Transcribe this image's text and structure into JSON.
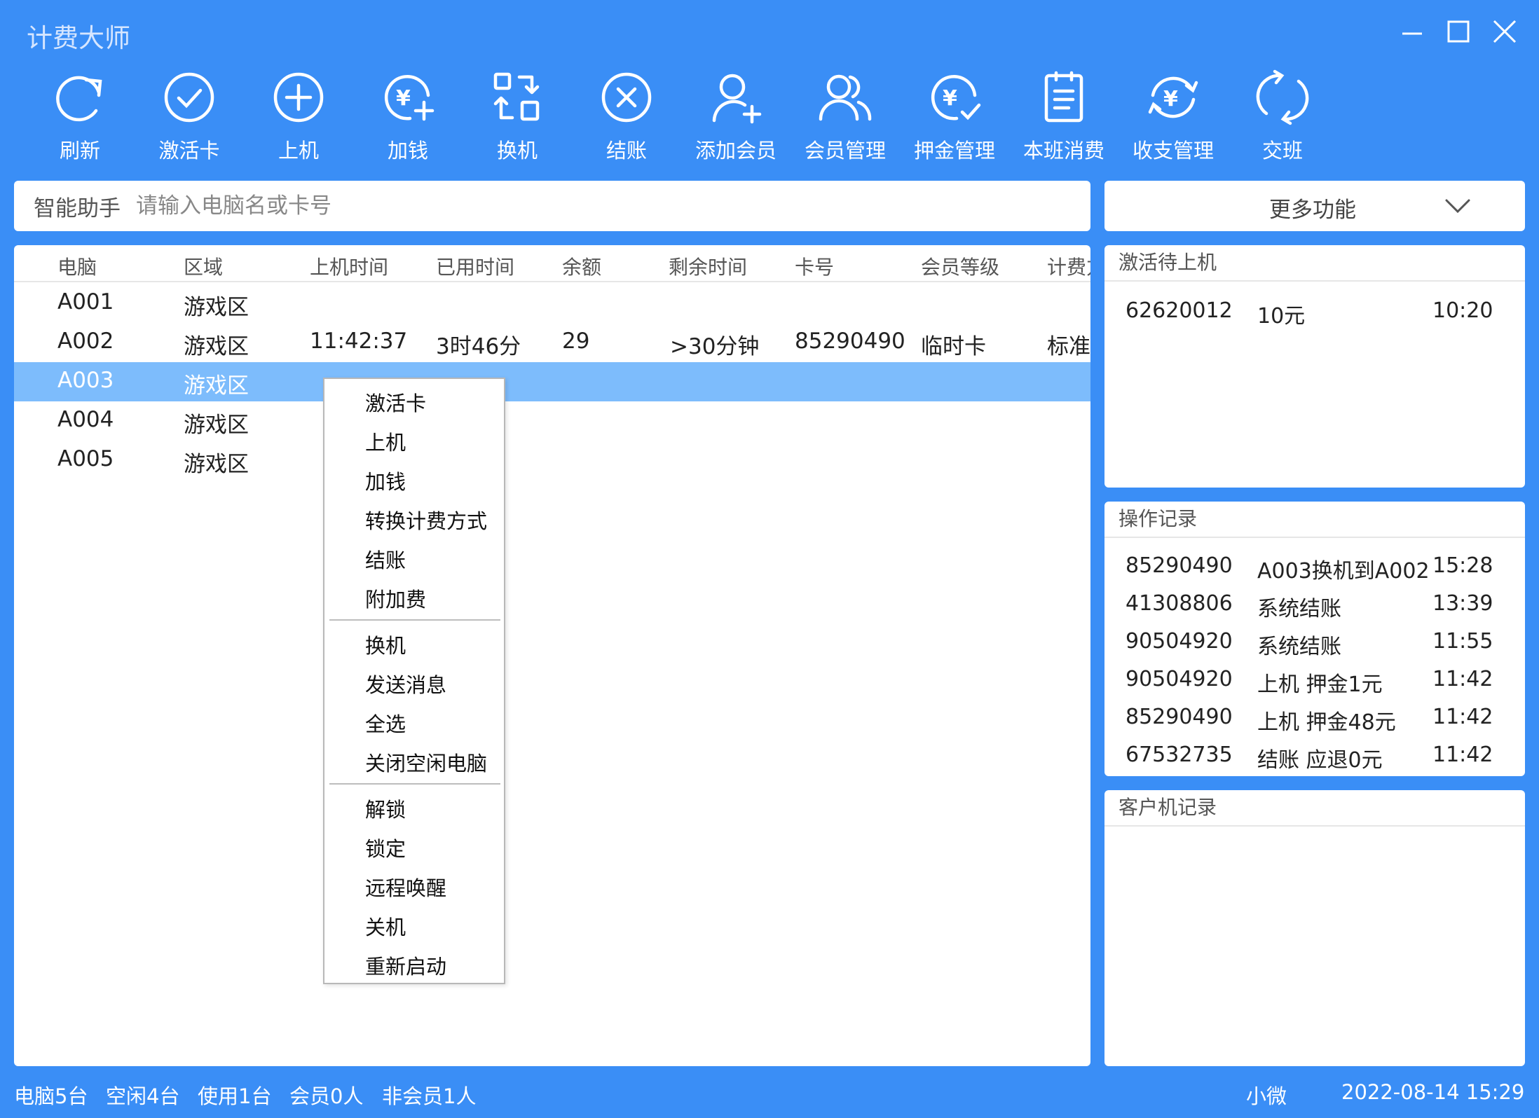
{
  "app_title": "计费大师",
  "window_controls": {
    "minimize": "minimize-icon",
    "maximize": "maximize-icon",
    "close": "close-icon"
  },
  "toolbar": [
    {
      "label": "刷新",
      "icon": "refresh-icon"
    },
    {
      "label": "激活卡",
      "icon": "check-circle-icon"
    },
    {
      "label": "上机",
      "icon": "plus-circle-icon"
    },
    {
      "label": "加钱",
      "icon": "yen-plus-icon"
    },
    {
      "label": "换机",
      "icon": "switch-icon"
    },
    {
      "label": "结账",
      "icon": "x-circle-icon"
    },
    {
      "label": "添加会员",
      "icon": "add-user-icon"
    },
    {
      "label": "会员管理",
      "icon": "users-icon"
    },
    {
      "label": "押金管理",
      "icon": "yen-check-icon"
    },
    {
      "label": "本班消费",
      "icon": "clipboard-icon"
    },
    {
      "label": "收支管理",
      "icon": "yen-cycle-icon"
    },
    {
      "label": "交班",
      "icon": "handover-icon"
    }
  ],
  "search": {
    "label": "智能助手",
    "placeholder": "请输入电脑名或卡号",
    "value": ""
  },
  "more": {
    "label": "更多功能",
    "icon": "chevron-down-icon"
  },
  "table": {
    "columns": [
      "电脑",
      "区域",
      "上机时间",
      "已用时间",
      "余额",
      "剩余时间",
      "卡号",
      "会员等级",
      "计费方"
    ],
    "rows": [
      [
        "A001",
        "游戏区",
        "",
        "",
        "",
        "",
        "",
        "",
        ""
      ],
      [
        "A002",
        "游戏区",
        "11:42:37",
        "3时46分",
        "29",
        ">30分钟",
        "85290490",
        "临时卡",
        "标准"
      ],
      [
        "A003",
        "游戏区",
        "",
        "",
        "",
        "",
        "",
        "",
        ""
      ],
      [
        "A004",
        "游戏区",
        "",
        "",
        "",
        "",
        "",
        "",
        ""
      ],
      [
        "A005",
        "游戏区",
        "",
        "",
        "",
        "",
        "",
        "",
        ""
      ]
    ],
    "selected_row": 2
  },
  "context_menu": {
    "groups": [
      [
        "激活卡",
        "上机",
        "加钱",
        "转换计费方式",
        "结账",
        "附加费"
      ],
      [
        "换机",
        "发送消息",
        "全选",
        "关闭空闲电脑"
      ],
      [
        "解锁",
        "锁定",
        "远程唤醒",
        "关机",
        "重新启动"
      ]
    ]
  },
  "panels": {
    "pending": {
      "title": "激活待上机",
      "rows": [
        [
          "62620012",
          "10元",
          "10:20"
        ]
      ]
    },
    "operations": {
      "title": "操作记录",
      "rows": [
        [
          "85290490",
          "A003换机到A002",
          "15:28"
        ],
        [
          "41308806",
          "系统结账",
          "13:39"
        ],
        [
          "90504920",
          "系统结账",
          "11:55"
        ],
        [
          "90504920",
          "上机 押金1元",
          "11:42"
        ],
        [
          "85290490",
          "上机 押金48元",
          "11:42"
        ],
        [
          "67532735",
          "结账 应退0元",
          "11:42"
        ]
      ]
    },
    "client_log": {
      "title": "客户机记录",
      "rows": []
    }
  },
  "status": {
    "items": [
      "电脑5台",
      "空闲4台",
      "使用1台",
      "会员0人",
      "非会员1人"
    ],
    "user": "小微",
    "datetime": "2022-08-14 15:29"
  }
}
